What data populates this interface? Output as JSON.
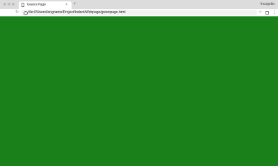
{
  "browser": {
    "tab": {
      "title": "Green Page",
      "close_icon": "×"
    },
    "new_tab_icon": "+",
    "profile_label": "Incognito",
    "toolbar": {
      "reload_icon": "↻",
      "url": "file:///Users/longname/Project/Indent/Webpage/greenpage.html",
      "star_icon": "☆",
      "menu_icon": "⋮"
    }
  },
  "page": {
    "background_color": "#1a801a"
  }
}
